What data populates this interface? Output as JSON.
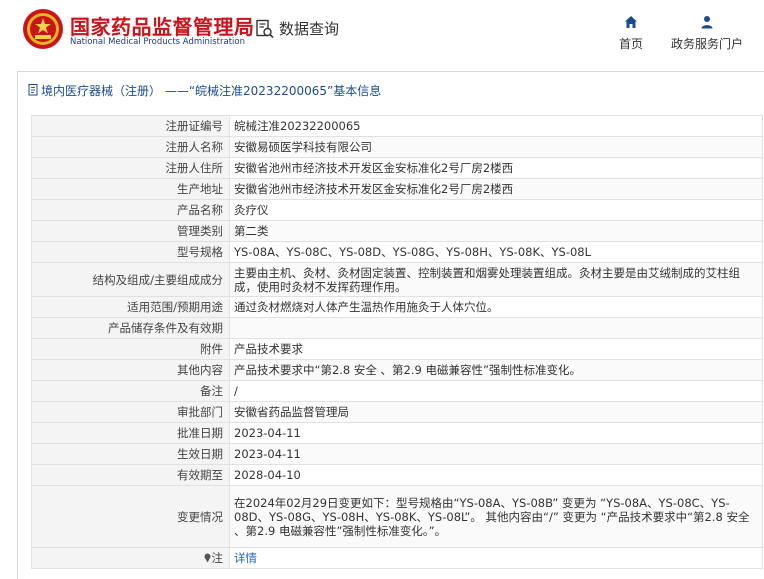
{
  "header": {
    "brand_cn": "国家药品监督管理局",
    "brand_en": "National Medical Products Administration",
    "query_label": "数据查询",
    "nav": [
      {
        "label": "首页",
        "icon": "home-icon"
      },
      {
        "label": "政务服务门户",
        "icon": "user-icon"
      }
    ]
  },
  "panel": {
    "title": "境内医疗器械（注册） ——“皖械注准20232200065”基本信息"
  },
  "rows": [
    {
      "key": "注册证编号",
      "value": "皖械注准20232200065"
    },
    {
      "key": "注册人名称",
      "value": "安徽易硕医学科技有限公司"
    },
    {
      "key": "注册人住所",
      "value": "安徽省池州市经济技术开发区金安标准化2号厂房2楼西"
    },
    {
      "key": "生产地址",
      "value": "安徽省池州市经济技术开发区金安标准化2号厂房2楼西"
    },
    {
      "key": "产品名称",
      "value": "灸疗仪"
    },
    {
      "key": "管理类别",
      "value": "第二类"
    },
    {
      "key": "型号规格",
      "value": "YS-08A、YS-08C、YS-08D、YS-08G、YS-08H、YS-08K、YS-08L"
    },
    {
      "key": "结构及组成/主要组成成分",
      "value": "主要由主机、灸材、灸材固定装置、控制装置和烟雾处理装置组成。灸材主要是由艾绒制成的艾柱组成，使用时灸材不发挥药理作用。"
    },
    {
      "key": "适用范围/预期用途",
      "value": "通过灸材燃烧对人体产生温热作用施灸于人体穴位。"
    },
    {
      "key": "产品储存条件及有效期",
      "value": ""
    },
    {
      "key": "附件",
      "value": "产品技术要求"
    },
    {
      "key": "其他内容",
      "value": "产品技术要求中“第2.8 安全 、第2.9 电磁兼容性”强制性标准变化。"
    },
    {
      "key": "备注",
      "value": "/"
    },
    {
      "key": "审批部门",
      "value": "安徽省药品监督管理局"
    },
    {
      "key": "批准日期",
      "value": "2023-04-11"
    },
    {
      "key": "生效日期",
      "value": "2023-04-11"
    },
    {
      "key": "有效期至",
      "value": "2028-04-10"
    },
    {
      "key": "变更情况",
      "value": "在2024年02月29日变更如下：型号规格由“YS-08A、YS-08B” 变更为 “YS-08A、YS-08C、YS-08D、YS-08G、YS-08H、YS-08K、YS-08L”。 其他内容由“/” 变更为 “产品技术要求中“第2.8 安全 、第2.9 电磁兼容性”强制性标准变化。”。"
    }
  ],
  "note_row": {
    "key": "注",
    "value": "详情",
    "icon": "info-pin-icon"
  },
  "colors": {
    "brand_red": "#c8141b",
    "link_blue": "#1a64c8",
    "title_blue": "#1a4c8c"
  }
}
